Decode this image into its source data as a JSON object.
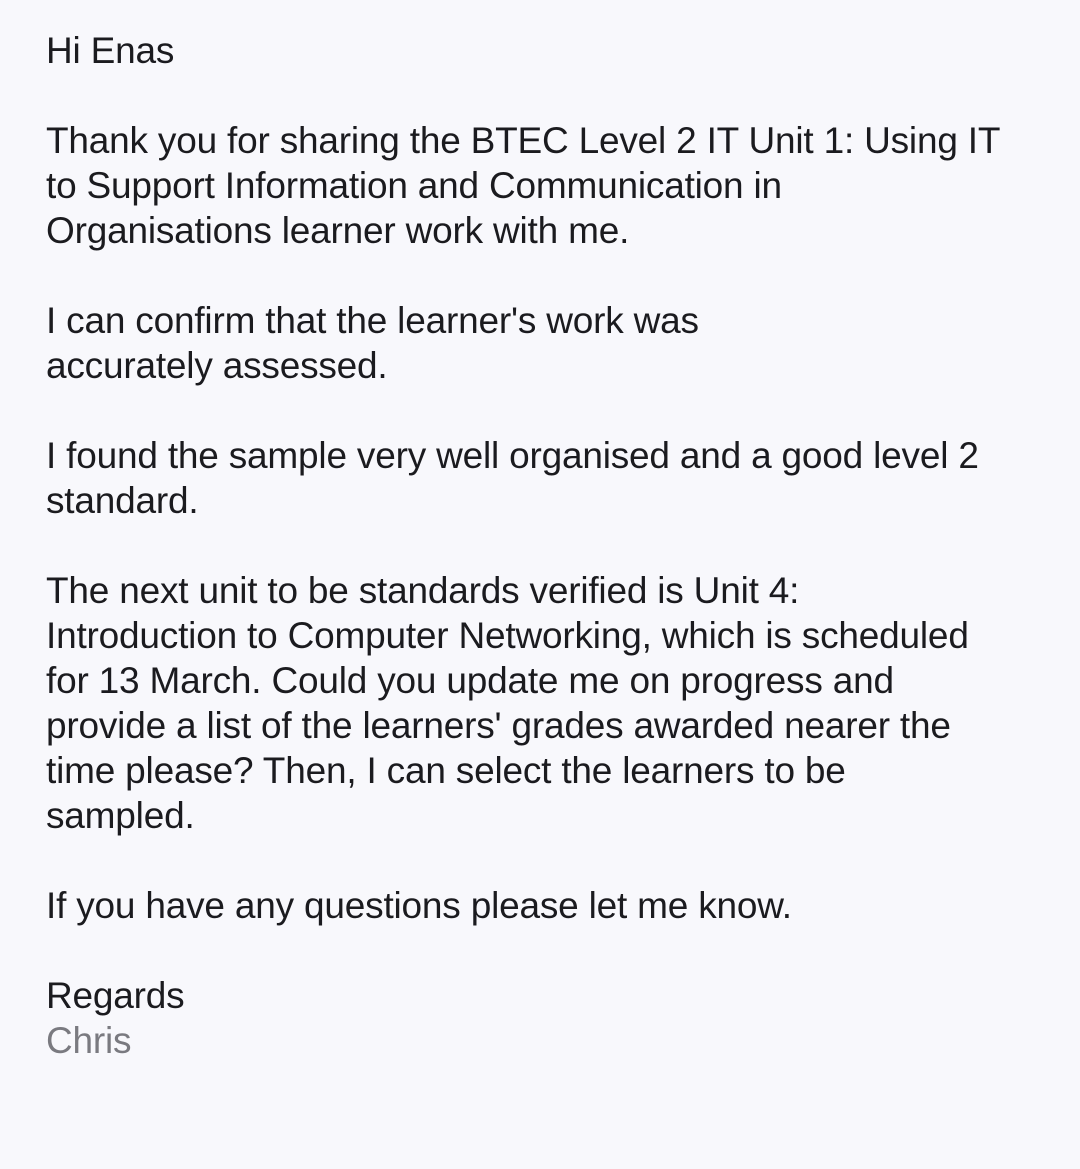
{
  "email": {
    "greeting": "Hi Enas",
    "paragraphs": [
      [
        "Thank you for sharing the BTEC Level 2 IT Unit 1: Using IT",
        "to Support Information and Communication in",
        "Organisations learner work with me."
      ],
      [
        "I can confirm that the learner's work was",
        "accurately assessed."
      ],
      [
        "I found the sample very well organised and a good level 2",
        "standard."
      ],
      [
        "The next unit to be standards verified is Unit 4:",
        "Introduction to Computer Networking, which is scheduled",
        "for 13 March. Could you update me on progress and",
        "provide a list of the learners' grades awarded nearer the",
        "time please? Then, I can select the learners to be",
        "sampled."
      ],
      [
        "If you have any questions please let me know."
      ]
    ],
    "signoff": "Regards",
    "sender_name": "Chris"
  },
  "colors": {
    "background": "#f8f8fc",
    "text": "#1b1b1f",
    "signature": "#7a7a80"
  }
}
